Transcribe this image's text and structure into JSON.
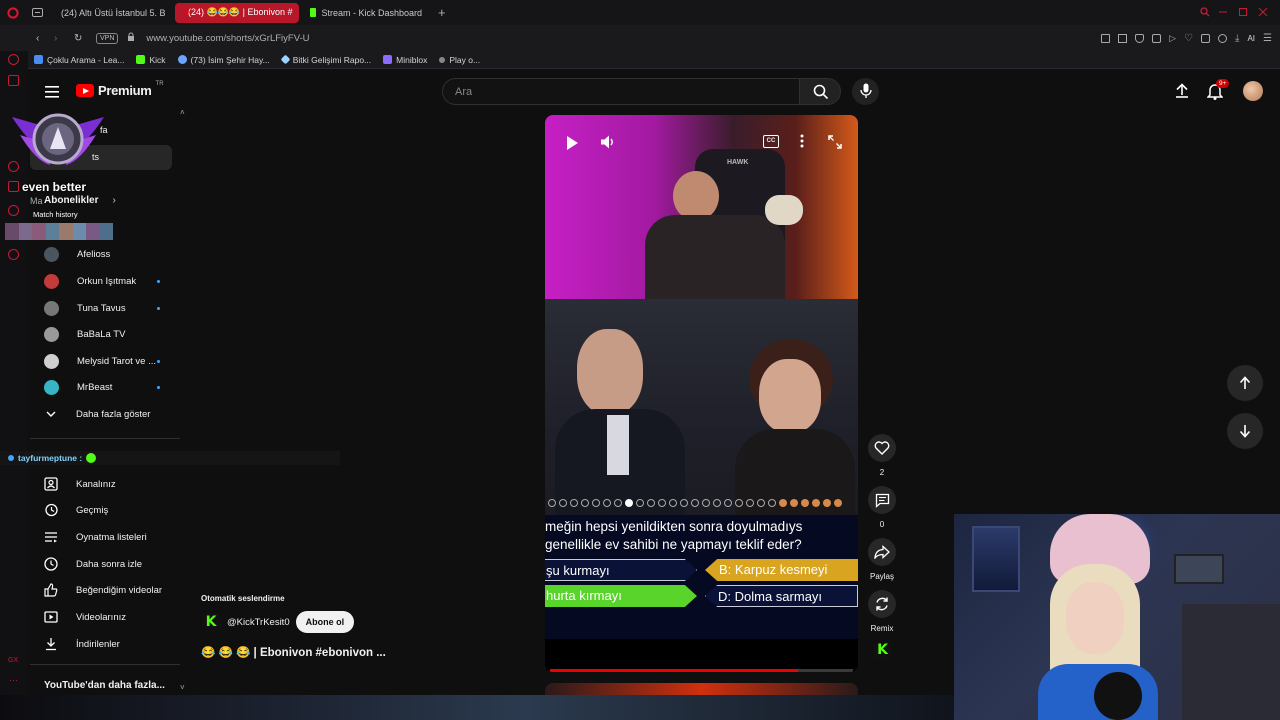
{
  "browser": {
    "tabs": [
      {
        "label": "(24) Altı Üstü İstanbul 5. B",
        "active": false
      },
      {
        "label": "(24) 😂😂😂 | Ebonivon #",
        "active": true
      },
      {
        "label": "Stream - Kick Dashboard",
        "active": false
      }
    ],
    "vpn_label": "VPN",
    "url": "www.youtube.com/shorts/xGrLFiyFV-U",
    "ai_label": "AI",
    "bookmarks": [
      {
        "label": "Çoklu Arama - Lea...",
        "color": "#4a8cf0"
      },
      {
        "label": "Kick",
        "color": "#53fc18"
      },
      {
        "label": "(73) İsim Şehir Hay...",
        "color": "#6aa6ff"
      },
      {
        "label": "Bitki Gelişimi Rapo...",
        "color": "#9fd3ff"
      },
      {
        "label": "Miniblox",
        "color": "#8a6cff"
      },
      {
        "label": "Play o...",
        "color": "#888888"
      }
    ]
  },
  "header": {
    "logo_text": "Premium",
    "logo_badge": "TR",
    "search_placeholder": "Ara",
    "notif_count": "9+"
  },
  "overlay": {
    "rank_text": "even better",
    "match_history": "Match history",
    "chat_user": "tayfurmeptune :"
  },
  "sidebar": {
    "partial_item_1": "fa",
    "partial_item_2": "ts",
    "partial_item_3": "Ma",
    "subscriptions_label": "Abonelikler",
    "subscriptions": [
      {
        "name": "Afelioss",
        "dot": false,
        "color": "#4a5560"
      },
      {
        "name": "Orkun Işıtmak",
        "dot": true,
        "color": "#c23a3a"
      },
      {
        "name": "Tuna Tavus",
        "dot": true,
        "color": "#777777"
      },
      {
        "name": "BaBaLa TV",
        "dot": false,
        "color": "#999999"
      },
      {
        "name": "Melysid Tarot ve ...",
        "dot": true,
        "color": "#cfcfcf"
      },
      {
        "name": "MrBeast",
        "dot": true,
        "color": "#38b5c4"
      }
    ],
    "show_more": "Daha fazla göster",
    "you_items": [
      "Kanalınız",
      "Geçmiş",
      "Oynatma listeleri",
      "Daha sonra izle",
      "Beğendiğim videolar",
      "Videolarınız",
      "İndirilenler"
    ],
    "more_from_youtube": "YouTube'dan daha fazla..."
  },
  "video": {
    "question_line1": "meğin hepsi yenildikten sonra doyulmadıys",
    "question_line2": "genellikle ev sahibi ne yapmayı teklif eder?",
    "answer_a": "şu kurmayı",
    "answer_b_letter": "B:",
    "answer_b": "Karpuz kesmeyi",
    "answer_c": "hurta kırmayı",
    "answer_d_letter": "D:",
    "answer_d": "Dolma sarmayı",
    "webcam_brand": "HAWK",
    "progress": 0.82,
    "autodub_label": "Otomatik seslendirme",
    "channel": "@KickTrKesit0",
    "subscribe": "Abone ol",
    "title": "😂 😂 😂 | Ebonivon #ebonivon ..."
  },
  "actions": {
    "likes": "2",
    "comments": "0",
    "share": "Paylaş",
    "remix": "Remix"
  },
  "colors": {
    "accent_red": "#ff0000",
    "kick_green": "#53fc18",
    "opera_red": "#c21d36",
    "answer_gold": "#d9a520",
    "answer_green": "#59d42a"
  }
}
